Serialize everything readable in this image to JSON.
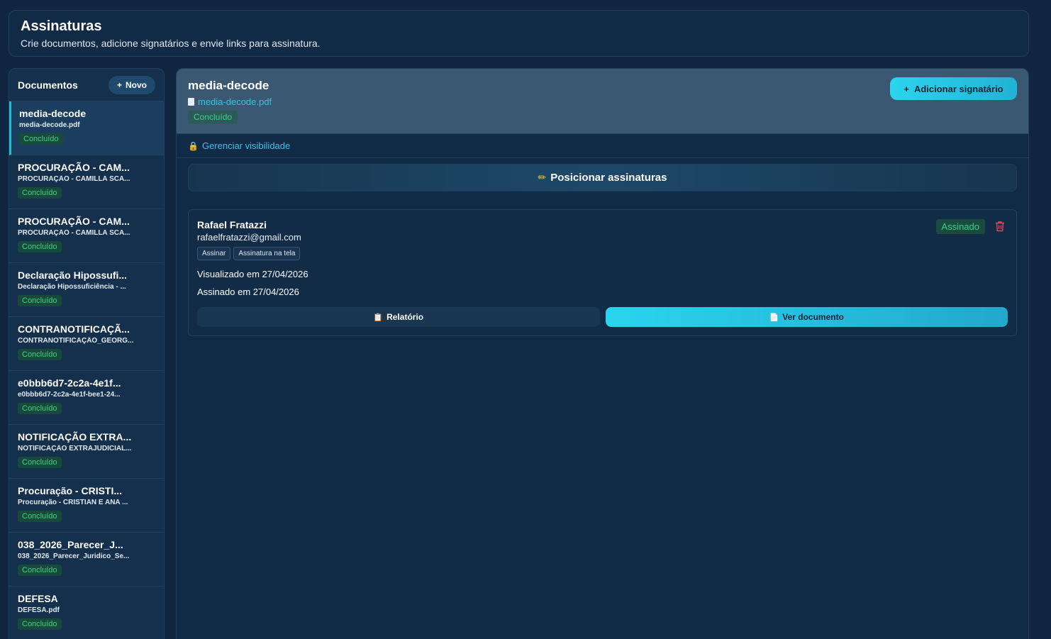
{
  "header": {
    "title": "Assinaturas",
    "subtitle": "Crie documentos, adicione signatários e envie links para assinatura."
  },
  "sidebar": {
    "title": "Documentos",
    "new_label": "Novo",
    "items": [
      {
        "name": "media-decode",
        "file": "media-decode.pdf",
        "status": "Concluído"
      },
      {
        "name": "PROCURAÇÃO - CAM...",
        "file": "PROCURAÇÃO - CAMILLA SCA...",
        "status": "Concluído"
      },
      {
        "name": "PROCURAÇÃO - CAM...",
        "file": "PROCURAÇÃO - CAMILLA SCA...",
        "status": "Concluído"
      },
      {
        "name": "Declaração Hipossufi...",
        "file": "Declaração Hipossuficiência - ...",
        "status": "Concluído"
      },
      {
        "name": "CONTRANOTIFICAÇÃ...",
        "file": "CONTRANOTIFICAÇÃO_GEORG...",
        "status": "Concluído"
      },
      {
        "name": "e0bbb6d7-2c2a-4e1f...",
        "file": "e0bbb6d7-2c2a-4e1f-bee1-24...",
        "status": "Concluído"
      },
      {
        "name": "NOTIFICAÇÃO EXTRA...",
        "file": "NOTIFICAÇÃO EXTRAJUDICIAL...",
        "status": "Concluído"
      },
      {
        "name": "Procuração - CRISTI...",
        "file": "Procuração - CRISTIAN E ANA ...",
        "status": "Concluído"
      },
      {
        "name": "038_2026_Parecer_J...",
        "file": "038_2026_Parecer_Juridico_Se...",
        "status": "Concluído"
      },
      {
        "name": "DEFESA",
        "file": "DEFESA.pdf",
        "status": "Concluído"
      }
    ]
  },
  "main": {
    "title": "media-decode",
    "file": "media-decode.pdf",
    "status": "Concluído",
    "add_signer_label": "Adicionar signatário",
    "visibility_label": "Gerenciar visibilidade",
    "position_label": "Posicionar assinaturas",
    "signer": {
      "name": "Rafael Fratazzi",
      "email": "rafaelfratazzi@gmail.com",
      "chips": [
        "Assinar",
        "Assinatura na tela"
      ],
      "viewed": "Visualizado em 27/04/2026",
      "signed": "Assinado em 27/04/2026",
      "status": "Assinado",
      "report_label": "Relatório",
      "view_label": "Ver documento"
    }
  },
  "colors": {
    "accent": "#2bd4ee",
    "success": "#3fd08a",
    "danger": "#e0455a",
    "background": "#0f2540"
  }
}
